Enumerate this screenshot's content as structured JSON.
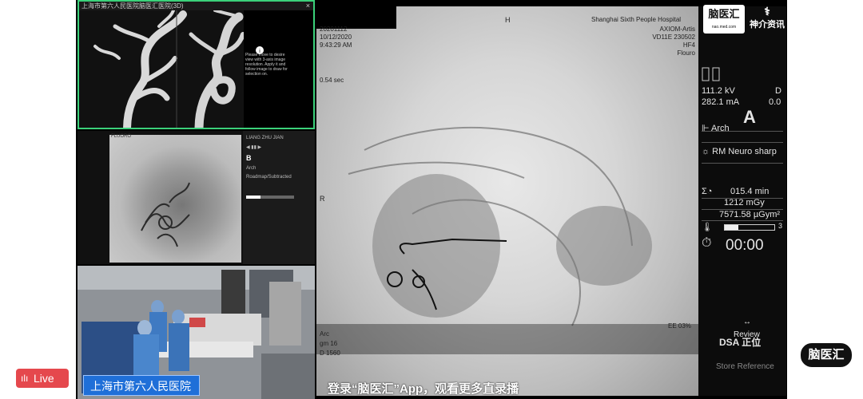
{
  "live": {
    "label": "Live",
    "icon": "live-bars-icon"
  },
  "panel_3d": {
    "title": "上海市第六人民医院脑医汇医院(3D)",
    "close_label": "×",
    "info_text": "Please move to desire view with 3-axis image resolution. Apply it and follow image to draw for selection on."
  },
  "angio_panel": {
    "header_left": "FLUORO",
    "header_right": "",
    "side_items": [
      "LIANG ZHU JIAN",
      "◀ ▮▮ ▶",
      "B",
      "Arch",
      "Roadmap/Subtracted"
    ],
    "side_letter": "B"
  },
  "main": {
    "hospital_overlay": "Shanghai Sixth People Hospital",
    "meta_right": [
      "AXIOM-Artis",
      "VD11E 230502",
      "HF4",
      "Flouro"
    ],
    "top_h": "H",
    "left_time": "0.54 sec",
    "left_r": "R",
    "bottom_left": [
      "Arc",
      "gm 16",
      "D 1560"
    ],
    "bottom_right": "EE 03%",
    "top_left_lines": [
      "20201112",
      "10/12/2020",
      "9:43:29 AM"
    ]
  },
  "right_panel": {
    "kv": "111.2 kV",
    "kv_right": "D",
    "ma": "282.1 mA",
    "ma_right": "0.0",
    "letter": "A",
    "arch": "Arch",
    "neuro": "RM Neuro sharp",
    "time": "015.4 min",
    "dose1": "1212 mGy",
    "dose2": "7571.58 µGym²",
    "bar_num": "3",
    "timer": "00:00",
    "review": "Review",
    "dsa": "DSA 正位",
    "store": "Store Reference"
  },
  "logos": {
    "naoyihui": "脑医汇",
    "naoyihui_sub": "nao.med.com",
    "shenjie": "神介资讯",
    "bottom_logo": "脑医汇"
  },
  "hospital_tag": "上海市第六人民医院",
  "caption": "登录“脑医汇”App，观看更多直录播",
  "colors": {
    "live": "#e5484d",
    "hospital_tag": "#1f6fd8",
    "panel_border": "#3bd17a"
  }
}
